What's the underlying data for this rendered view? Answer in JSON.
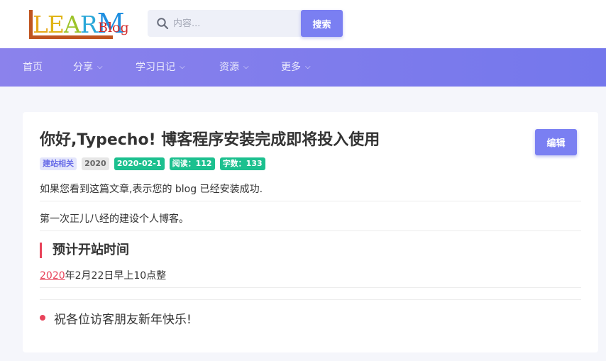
{
  "header": {
    "logo": {
      "letters": [
        "L",
        "E",
        "A",
        "R",
        "M"
      ],
      "word": "Blog"
    },
    "search": {
      "placeholder": "内容...",
      "value": "",
      "button_label": "搜索"
    }
  },
  "nav": {
    "items": [
      {
        "label": "首页",
        "has_dropdown": false
      },
      {
        "label": "分享",
        "has_dropdown": true
      },
      {
        "label": "学习日记",
        "has_dropdown": true
      },
      {
        "label": "资源",
        "has_dropdown": true
      },
      {
        "label": "更多",
        "has_dropdown": true
      }
    ]
  },
  "article": {
    "title": "你好,Typecho! 博客程序安装完成即将投入使用",
    "edit_label": "编辑",
    "tags": {
      "category": "建站相关",
      "year": "2020",
      "date": "2020-02-1",
      "reads": "阅读：112",
      "words": "字数：133"
    },
    "paragraph1": "如果您看到这篇文章,表示您的 blog 已经安装成功.",
    "paragraph2": "第一次正儿八经的建设个人博客。",
    "heading": "预计开站时间",
    "time_link": "2020",
    "time_rest": "年2月22日早上10点整",
    "list_item": "祝各位访客朋友新年快乐!"
  },
  "colors": {
    "accent": "#7a7ff2",
    "nav_start": "#8b82ec",
    "nav_end": "#7477ec",
    "highlight": "#e8435a",
    "tag_green": "#1cc08f"
  }
}
